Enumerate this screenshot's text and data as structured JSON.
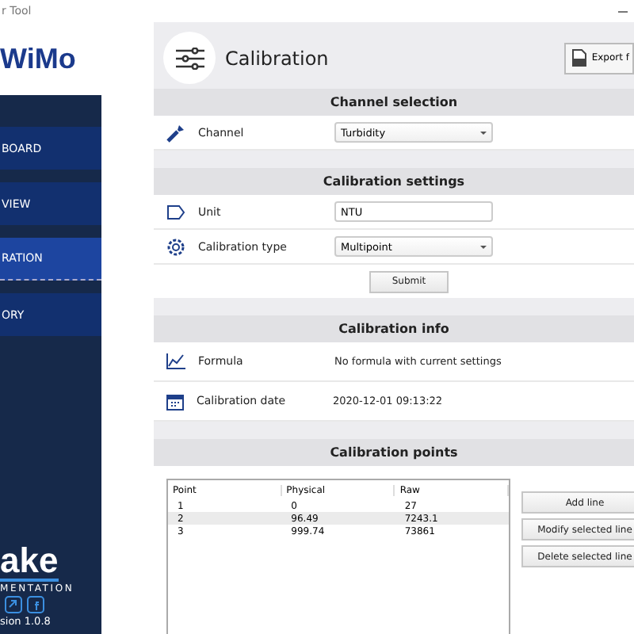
{
  "window": {
    "title": "r Tool"
  },
  "sidebar": {
    "logo": "WiMo",
    "items": [
      {
        "label": "BOARD",
        "selected": false
      },
      {
        "label": "VIEW",
        "selected": false
      },
      {
        "label": "RATION",
        "selected": true
      },
      {
        "label": "ORY",
        "selected": false
      }
    ],
    "brand": "ake",
    "brand_sub": "MENTATION",
    "version": "sion 1.0.8"
  },
  "header": {
    "title": "Calibration",
    "export_button": "Export f"
  },
  "channel_selection": {
    "title": "Channel selection",
    "label": "Channel",
    "value": "Turbidity"
  },
  "calibration_settings": {
    "title": "Calibration settings",
    "unit_label": "Unit",
    "unit_value": "NTU",
    "type_label": "Calibration type",
    "type_value": "Multipoint",
    "submit": "Submit"
  },
  "calibration_info": {
    "title": "Calibration info",
    "formula_label": "Formula",
    "formula_value": "No formula with current settings",
    "date_label": "Calibration date",
    "date_value": "2020-12-01 09:13:22"
  },
  "calibration_points": {
    "title": "Calibration points",
    "columns": [
      "Point",
      "Physical",
      "Raw"
    ],
    "rows": [
      {
        "cells": [
          "1",
          "0",
          "27"
        ],
        "selected": false
      },
      {
        "cells": [
          "2",
          "96.49",
          "7243.1"
        ],
        "selected": true
      },
      {
        "cells": [
          "3",
          "999.74",
          "73861"
        ],
        "selected": false
      }
    ],
    "buttons": [
      "Add line",
      "Modify selected line",
      "Delete selected line"
    ]
  }
}
